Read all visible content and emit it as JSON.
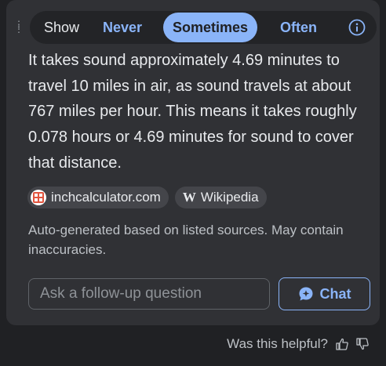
{
  "toggle": {
    "show_label": "Show",
    "options": [
      "Never",
      "Sometimes",
      "Often"
    ],
    "selected": "Sometimes"
  },
  "answer": {
    "text": "It takes sound approximately 4.69 minutes to travel 10 miles in air, as sound travels at about 767 miles per hour. This means it takes roughly 0.078 hours or 4.69 minutes for sound to cover that distance."
  },
  "sources": [
    {
      "label": "inchcalculator.com",
      "icon": "calculator-icon"
    },
    {
      "label": "Wikipedia",
      "icon": "wikipedia-icon"
    }
  ],
  "disclaimer": "Auto-generated based on listed sources. May contain inaccuracies.",
  "followup": {
    "placeholder": "Ask a follow-up question",
    "chat_label": "Chat"
  },
  "feedback": {
    "question": "Was this helpful?"
  },
  "colors": {
    "accent": "#8ab4f8",
    "card": "#303135",
    "background": "#202124"
  }
}
